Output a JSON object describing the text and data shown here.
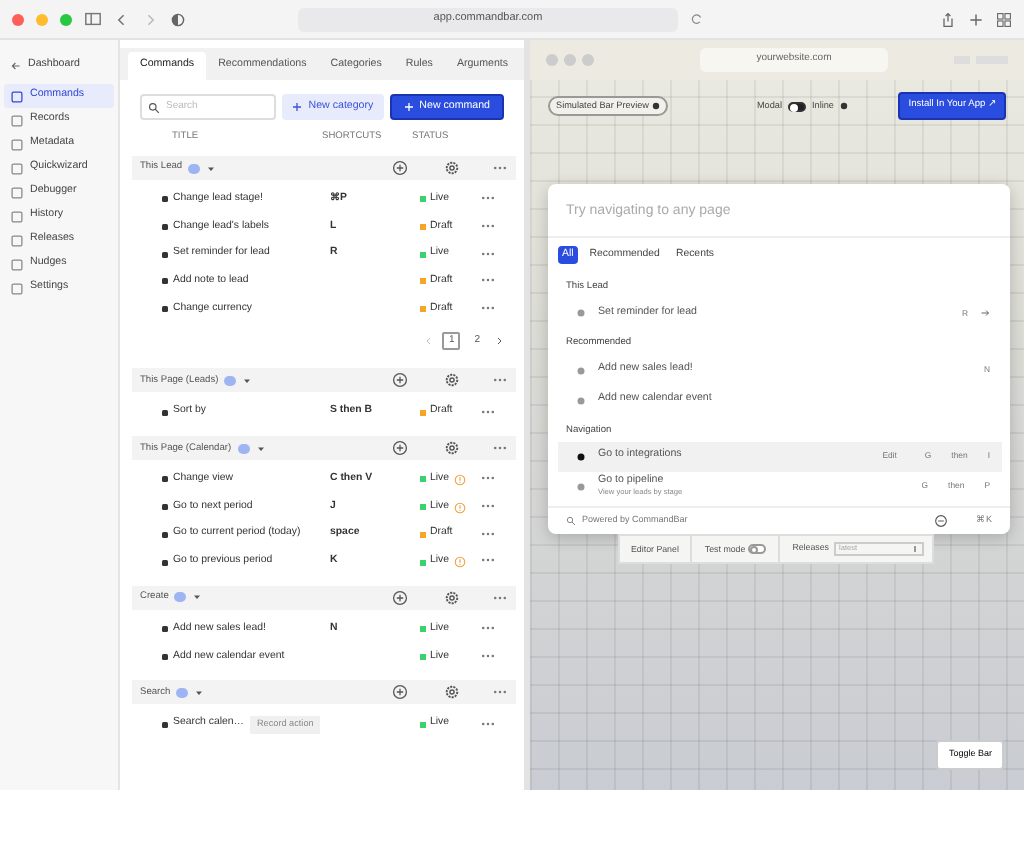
{
  "browser": {
    "url": "app.commandbar.com"
  },
  "sidebar": {
    "back": "Dashboard",
    "items": [
      {
        "label": "Commands",
        "selected": true
      },
      {
        "label": "Records",
        "selected": false
      },
      {
        "label": "Metadata",
        "selected": false
      },
      {
        "label": "Quickwizard",
        "selected": false
      },
      {
        "label": "Debugger",
        "selected": false
      },
      {
        "label": "History",
        "selected": false
      },
      {
        "label": "Releases",
        "selected": false
      },
      {
        "label": "Nudges",
        "selected": false
      },
      {
        "label": "Settings",
        "selected": false
      }
    ]
  },
  "tabs": [
    {
      "label": "Commands",
      "selected": true
    },
    {
      "label": "Recommendations",
      "selected": false
    },
    {
      "label": "Categories",
      "selected": false
    },
    {
      "label": "Rules",
      "selected": false
    },
    {
      "label": "Arguments",
      "selected": false
    }
  ],
  "toolbar": {
    "search_placeholder": "Search",
    "new_category": "New category",
    "new_command": "New command"
  },
  "columns": [
    "TITLE",
    "SHORTCUTS",
    "STATUS"
  ],
  "groups": [
    {
      "title": "This Lead",
      "commands": [
        {
          "title": "Change lead stage!",
          "shortcut": "⌘P",
          "status": {
            "label": "Live",
            "color": "#3ecf6e"
          },
          "warning": false
        },
        {
          "title": "Change lead's labels",
          "shortcut": "L",
          "status": {
            "label": "Draft",
            "color": "#f5a623"
          },
          "warning": false
        },
        {
          "title": "Set reminder for lead",
          "shortcut": "R",
          "status": {
            "label": "Live",
            "color": "#3ecf6e"
          },
          "warning": false
        },
        {
          "title": "Add note to lead",
          "status": {
            "label": "Draft",
            "color": "#f5a623"
          },
          "warning": false
        },
        {
          "title": "Change currency",
          "status": {
            "label": "Draft",
            "color": "#f5a623"
          },
          "warning": false
        }
      ],
      "pagination": [
        {
          "label": "1",
          "selected": true
        },
        {
          "label": "2",
          "selected": false
        }
      ]
    },
    {
      "title": "This Page (Leads)",
      "commands": [
        {
          "title": "Sort by",
          "shortcut": "S then B",
          "status": {
            "label": "Draft",
            "color": "#f5a623"
          },
          "warning": false
        }
      ]
    },
    {
      "title": "This Page (Calendar)",
      "commands": [
        {
          "title": "Change view",
          "shortcut": "C then V",
          "status": {
            "label": "Live",
            "color": "#3ecf6e"
          },
          "warning": true
        },
        {
          "title": "Go to next period",
          "shortcut": "J",
          "status": {
            "label": "Live",
            "color": "#3ecf6e"
          },
          "warning": true
        },
        {
          "title": "Go to current period (today)",
          "shortcut": "space",
          "status": {
            "label": "Draft",
            "color": "#f5a623"
          },
          "warning": false
        },
        {
          "title": "Go to previous period",
          "shortcut": "K",
          "status": {
            "label": "Live",
            "color": "#3ecf6e"
          },
          "warning": true
        }
      ]
    },
    {
      "title": "Create",
      "commands": [
        {
          "title": "Add new sales lead!",
          "shortcut": "N",
          "status": {
            "label": "Live",
            "color": "#3ecf6e"
          },
          "warning": false
        },
        {
          "title": "Add new calendar event",
          "status": {
            "label": "Live",
            "color": "#3ecf6e"
          },
          "warning": false
        }
      ]
    },
    {
      "title": "Search",
      "commands": [
        {
          "title": "Search calen…",
          "tag": "Record action",
          "status": {
            "label": "Live",
            "color": "#3ecf6e"
          },
          "warning": false
        }
      ]
    }
  ],
  "preview": {
    "url": "yourwebsite.com",
    "simulated_label": "Simulated Bar Preview",
    "modal_label": "Modal",
    "inline_label": "Inline",
    "inline": false,
    "install_button": "Install In Your App ↗",
    "bar": {
      "placeholder": "Try navigating to any page",
      "tabs": [
        {
          "label": "All",
          "selected": true
        },
        {
          "label": "Recommended",
          "selected": false
        },
        {
          "label": "Recents",
          "selected": false
        }
      ],
      "sections": [
        {
          "title": "This Lead",
          "items": [
            {
              "title": "Set reminder for lead",
              "keys": [
                "R"
              ],
              "arrow": true,
              "selected": false
            }
          ]
        },
        {
          "title": "Recommended",
          "items": [
            {
              "title": "Add new sales lead!",
              "keys": [
                "N"
              ],
              "arrow": false,
              "selected": false
            },
            {
              "title": "Add new calendar event",
              "arrow": false,
              "selected": false
            }
          ]
        },
        {
          "title": "Navigation",
          "items": [
            {
              "title": "Go to integrations",
              "hint": "Edit",
              "keys": [
                "G",
                "then",
                "I"
              ],
              "arrow": false,
              "selected": true
            },
            {
              "title": "Go to pipeline",
              "subtitle": "View your leads by stage",
              "keys": [
                "G",
                "then",
                "P"
              ],
              "arrow": false,
              "selected": false
            }
          ]
        }
      ],
      "footer": "Powered by CommandBar",
      "footer_shortcut": "⌘K"
    },
    "editor": {
      "label": "Editor Panel",
      "test_mode_label": "Test mode",
      "test_mode": false,
      "releases_label": "Releases",
      "releases_value": "latest"
    },
    "toggle_button": "Toggle Bar"
  }
}
